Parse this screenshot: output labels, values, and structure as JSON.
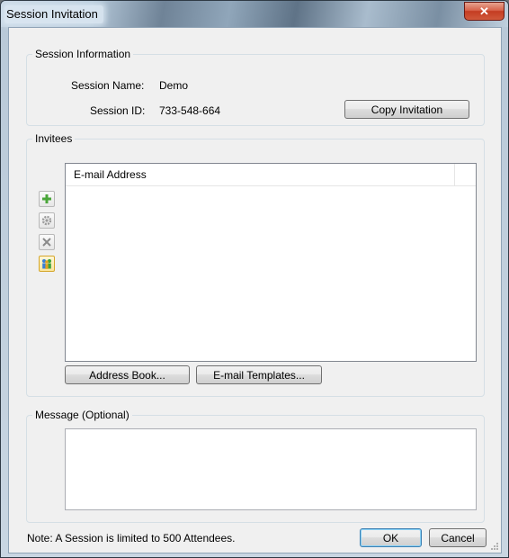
{
  "window": {
    "title": "Session Invitation",
    "close_glyph": "✕"
  },
  "session_info": {
    "legend": "Session Information",
    "name_label": "Session Name:",
    "name_value": "Demo",
    "id_label": "Session ID:",
    "id_value": "733-548-664",
    "copy_button": "Copy Invitation"
  },
  "invitees": {
    "legend": "Invitees",
    "column_header": "E-mail Address",
    "toolbar": [
      "add-icon",
      "gear-icon",
      "delete-icon",
      "people-icon"
    ],
    "address_book_button": "Address Book...",
    "email_templates_button": "E-mail Templates..."
  },
  "message": {
    "legend": "Message (Optional)",
    "value": ""
  },
  "footer": {
    "note": "Note: A Session is limited to 500 Attendees.",
    "ok_button": "OK",
    "cancel_button": "Cancel"
  }
}
